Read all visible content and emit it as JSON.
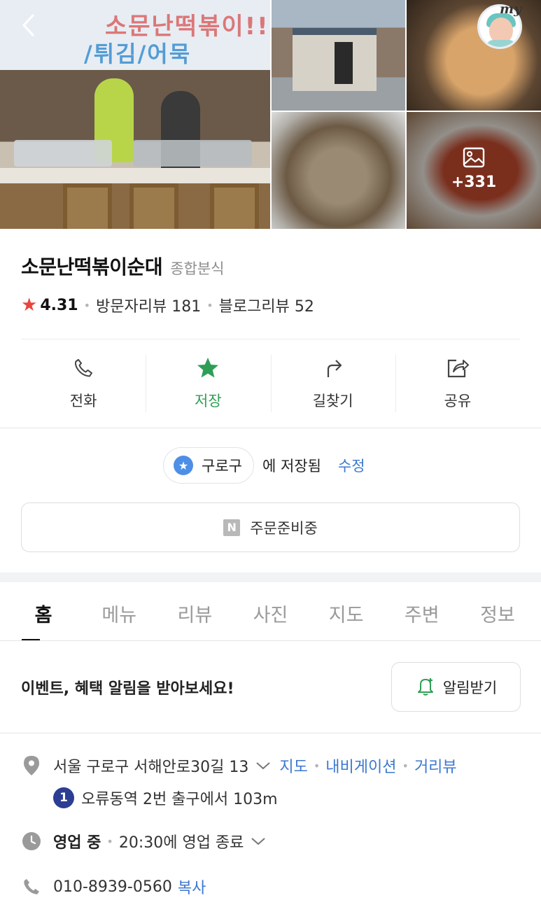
{
  "header": {
    "back_icon": "chevron-left-icon",
    "my_label": "my",
    "photo_more_count": "+331",
    "banner_line1": "소문난떡볶이!!",
    "banner_line2": "/튀김/어묵"
  },
  "place": {
    "name": "소문난떡볶이순대",
    "category": "종합분식",
    "rating": "4.31",
    "visitor_reviews": "방문자리뷰 181",
    "blog_reviews": "블로그리뷰 52"
  },
  "actions": [
    {
      "label": "전화",
      "icon": "phone-icon"
    },
    {
      "label": "저장",
      "icon": "star-icon"
    },
    {
      "label": "길찾기",
      "icon": "directions-icon"
    },
    {
      "label": "공유",
      "icon": "share-icon"
    }
  ],
  "saved": {
    "folder": "구로구",
    "status_text": "에 저장됨",
    "edit_label": "수정"
  },
  "order": {
    "badge": "N",
    "label": "주문준비중"
  },
  "tabs": [
    "홈",
    "메뉴",
    "리뷰",
    "사진",
    "지도",
    "주변",
    "정보"
  ],
  "event": {
    "text": "이벤트, 혜택 알림을 받아보세요!",
    "button_label": "알림받기"
  },
  "info": {
    "address": "서울 구로구 서해안로30길 13",
    "map_link": "지도",
    "navi_link": "내비게이션",
    "street_link": "거리뷰",
    "subway_line": "1",
    "subway_text": "오류동역 2번 출구에서 103m",
    "hours_status": "영업 중",
    "hours_text": "20:30에 영업 종료",
    "phone": "010-8939-0560",
    "copy_label": "복사"
  },
  "colors": {
    "accent_green": "#2f9e55",
    "link_blue": "#3b78d0",
    "star_red": "#e8453c",
    "subway_line1": "#2c3e93"
  }
}
